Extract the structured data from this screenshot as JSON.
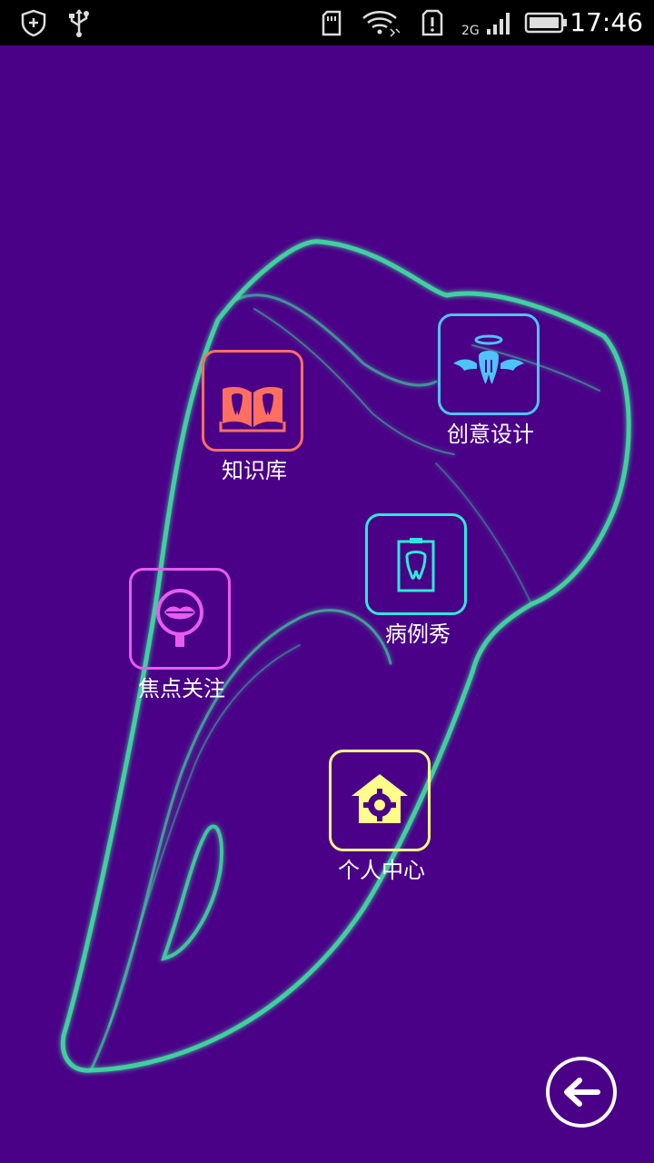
{
  "status_bar": {
    "network_type": "2G",
    "time": "17:46",
    "icons": [
      "shield-icon",
      "usb-icon",
      "sd-card-icon",
      "wifi-icon",
      "sim-alert-icon",
      "signal-icon",
      "battery-icon"
    ]
  },
  "menu": {
    "knowledge": {
      "label": "知识库",
      "icon": "tooth-book-icon",
      "color": "#ff6f61"
    },
    "creative": {
      "label": "创意设计",
      "icon": "winged-tooth-icon",
      "color": "#4fc3f7"
    },
    "cases": {
      "label": "病例秀",
      "icon": "tooth-clipboard-icon",
      "color": "#2ee8d6"
    },
    "focus": {
      "label": "焦点关注",
      "icon": "lips-magnifier-icon",
      "color": "#e65cf0"
    },
    "personal": {
      "label": "个人中心",
      "icon": "home-gear-icon",
      "color": "#fffc8a"
    }
  },
  "back_button": {
    "icon": "back-arrow-icon"
  },
  "colors": {
    "background": "#4a0087",
    "tooth_outline": "#3fe0a0"
  }
}
